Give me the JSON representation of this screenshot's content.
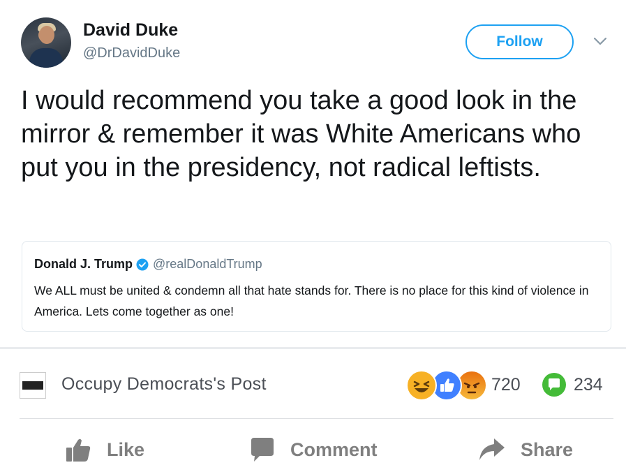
{
  "tweet": {
    "author_name": "David Duke",
    "author_handle": "@DrDavidDuke",
    "follow_label": "Follow",
    "text": "I would recommend you take a good look in the mirror & remember it was White Americans who put you in the presidency, not radical leftists.",
    "quoted": {
      "author_name": "Donald J. Trump",
      "author_handle": "@realDonaldTrump",
      "text": "We ALL must be united & condemn all that hate stands for. There is no place for this kind of violence in America. Lets come together as one!"
    }
  },
  "facebook": {
    "post_title": "Occupy Democrats's Post",
    "reactions": [
      "haha-icon",
      "like-icon",
      "angry-icon"
    ],
    "reaction_count": "720",
    "comment_count": "234",
    "actions": {
      "like": "Like",
      "comment": "Comment",
      "share": "Share"
    }
  },
  "colors": {
    "twitter_blue": "#1da1f2",
    "fb_gray": "#7f7f7f",
    "comment_green": "#44bb38"
  }
}
